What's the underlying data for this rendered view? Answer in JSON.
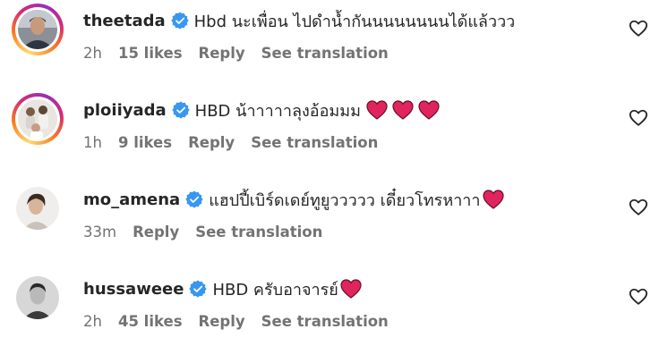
{
  "comments": [
    {
      "username": "theetada",
      "text": "Hbd นะเพื่อน ไปดำน้ำกันนนนนนนนได้แล้ววว",
      "time": "2h",
      "likes": "15 likes",
      "reply": "Reply",
      "translate": "See translation",
      "hearts": 0,
      "story_ring": true
    },
    {
      "username": "ploiiyada",
      "text": "HBD น้าาาาาลุงอ้อมมม",
      "time": "1h",
      "likes": "9 likes",
      "reply": "Reply",
      "translate": "See translation",
      "hearts": 3,
      "story_ring": true
    },
    {
      "username": "mo_amena",
      "text": "แฮปปี้เบิร์ดเดย์ทูยูววววว เดี๋ยวโทรหาาา",
      "time": "33m",
      "likes": "",
      "reply": "Reply",
      "translate": "See translation",
      "hearts": 1,
      "story_ring": false
    },
    {
      "username": "hussaweee",
      "text": "HBD ครับอาจารย์",
      "time": "2h",
      "likes": "45 likes",
      "reply": "Reply",
      "translate": "See translation",
      "hearts": 1,
      "story_ring": false
    }
  ],
  "colors": {
    "verified": "#3897f0",
    "heart": "#e0245e",
    "meta": "#737373",
    "text": "#262626"
  }
}
